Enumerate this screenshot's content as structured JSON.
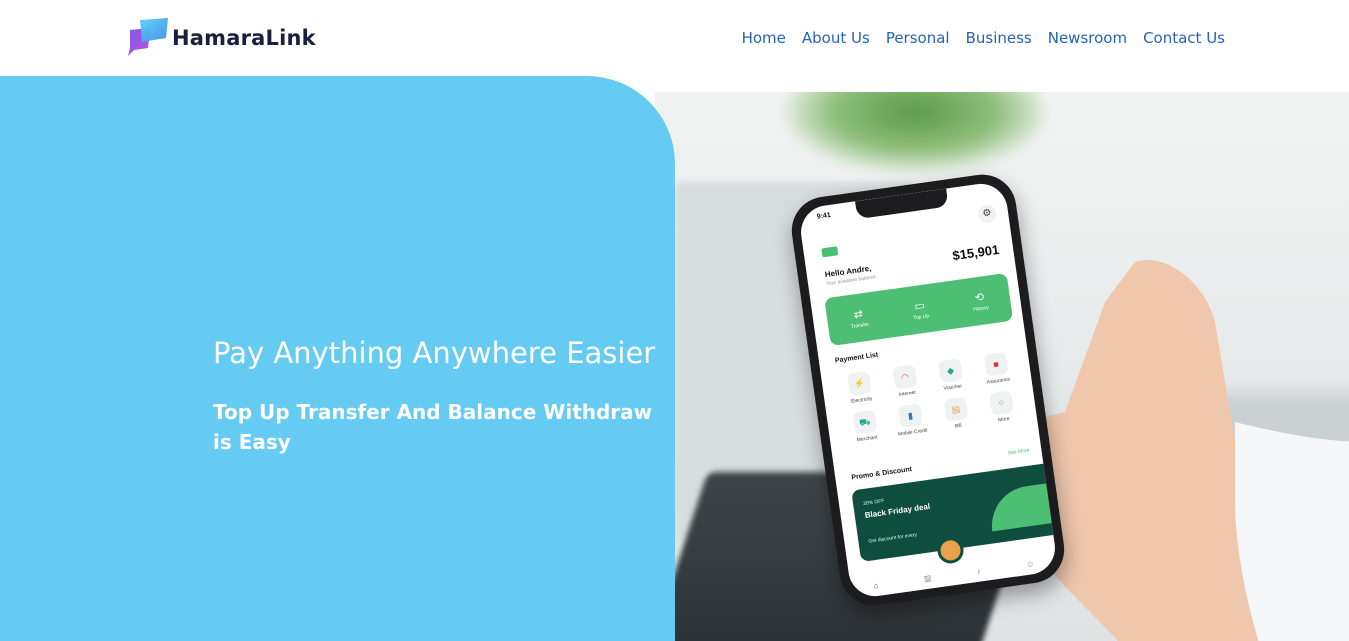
{
  "brand": {
    "name": "HamaraLink",
    "logo_icon": "chat-bubble-logo-icon"
  },
  "nav": {
    "items": [
      "Home",
      "About Us",
      "Personal",
      "Business",
      "Newsroom",
      "Contact Us"
    ]
  },
  "hero": {
    "title": "Pay Anything Anywhere Easier",
    "subtitle": "Top Up Transfer And Balance Withdraw is Easy",
    "image_icon": "phone-app-hero-image",
    "accent": "#66cbf3",
    "nav_color": "#2563b8"
  },
  "phone": {
    "time": "9:41",
    "greeting": "Hello Andre,",
    "available_label": "Your available balance",
    "balance": "$15,901",
    "actions": [
      "Transfer",
      "Top Up",
      "History"
    ],
    "payment_list_title": "Payment List",
    "payment_items": [
      "Electricity",
      "Internet",
      "Voucher",
      "Assurance",
      "Merchant",
      "Mobile Credit",
      "Bill",
      "More"
    ],
    "promo_title": "Promo & Discount",
    "see_more": "See More",
    "promo_off": "30% OFF",
    "promo_deal": "Black Friday deal",
    "promo_detail": "Get discount for every",
    "brand_green": "#4cbf74"
  }
}
